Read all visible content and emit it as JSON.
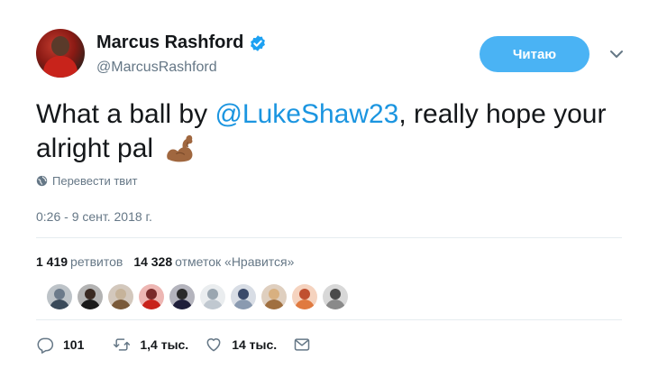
{
  "user": {
    "display_name": "Marcus Rashford",
    "handle": "@MarcusRashford"
  },
  "follow_button": {
    "label": "Читаю"
  },
  "tweet": {
    "text_before": "What a ball by ",
    "mention": "@LukeShaw23",
    "text_after": ", really hope your alright pal",
    "emoji": "flexed-biceps-icon",
    "translate_label": "Перевести твит",
    "timestamp": "0:26 - 9 сент. 2018 г."
  },
  "stats": {
    "retweets_count": "1 419",
    "retweets_label": "ретвитов",
    "likes_count": "14 328",
    "likes_label": "отметок «Нравится»"
  },
  "liker_avatars": [
    {
      "head": "#6b7a8a",
      "body": "#3a4a5a"
    },
    {
      "head": "#3a2a22",
      "body": "#1a1a1a"
    },
    {
      "head": "#c6b39a",
      "body": "#7a5a3a"
    },
    {
      "head": "#7a2a2a",
      "body": "#c8231b"
    },
    {
      "head": "#2a2a2a",
      "body": "#1f1f3a"
    },
    {
      "head": "#9aa6b0",
      "body": "#c0c8d0"
    },
    {
      "head": "#3a4a6a",
      "body": "#8a9ab0"
    },
    {
      "head": "#d8b080",
      "body": "#a07040"
    },
    {
      "head": "#c05030",
      "body": "#e07a40"
    },
    {
      "head": "#4a4a4a",
      "body": "#8a8a8a"
    }
  ],
  "actions": {
    "replies": "101",
    "retweets": "1,4 тыс.",
    "likes": "14 тыс."
  },
  "colors": {
    "accent": "#1b95e0",
    "follow_bg": "#4ab3f4",
    "muted": "#657786"
  }
}
